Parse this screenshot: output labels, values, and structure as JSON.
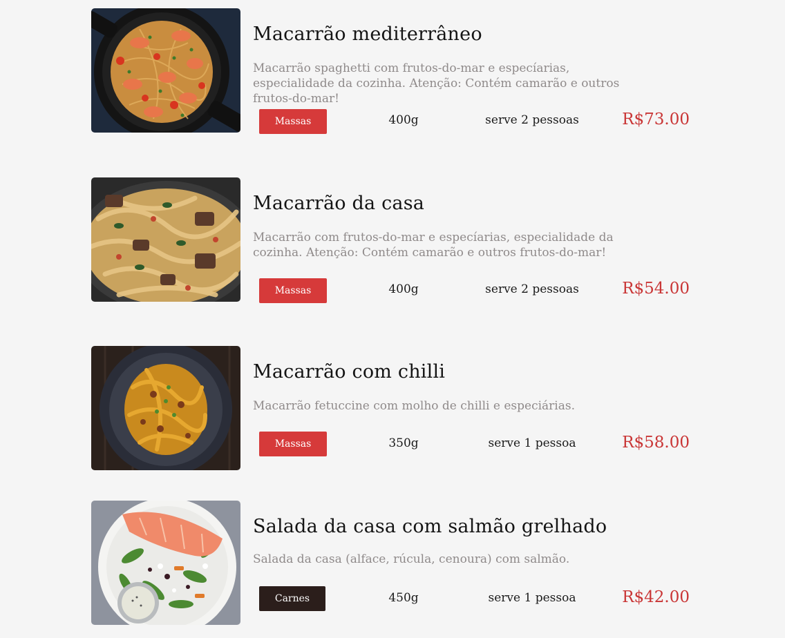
{
  "dishes": [
    {
      "name": "Macarrão mediterrâneo",
      "description": "Macarrão spaghetti com frutos-do-mar e especíarias, especialidade da cozinha. Atenção: Contém camarão e outros frutos-do-mar!",
      "category": "Massas",
      "weight": "400g",
      "serves": "serve 2 pessoas",
      "price": "R$73.00"
    },
    {
      "name": "Macarrão da casa",
      "description": "Macarrão com frutos-do-mar e especíarias, especialidade da cozinha. Atenção: Contém camarão e outros frutos-do-mar!",
      "category": "Massas",
      "weight": "400g",
      "serves": "serve 2 pessoas",
      "price": "R$54.00"
    },
    {
      "name": "Macarrão com chilli",
      "description": "Macarrão fetuccine com molho de chilli e especiárias.",
      "category": "Massas",
      "weight": "350g",
      "serves": "serve 1 pessoa",
      "price": "R$58.00"
    },
    {
      "name": "Salada da casa com salmão grelhado",
      "description": "Salada da casa (alface, rúcula, cenoura) com salmão.",
      "category": "Carnes",
      "weight": "450g",
      "serves": "serve 1 pessoa",
      "price": "R$42.00"
    }
  ],
  "colors": {
    "background": "#f5f5f5",
    "massas_tag": "#d63a3a",
    "carnes_tag": "#2b1e1b",
    "price": "#c93535",
    "description": "#8f8a8a"
  }
}
